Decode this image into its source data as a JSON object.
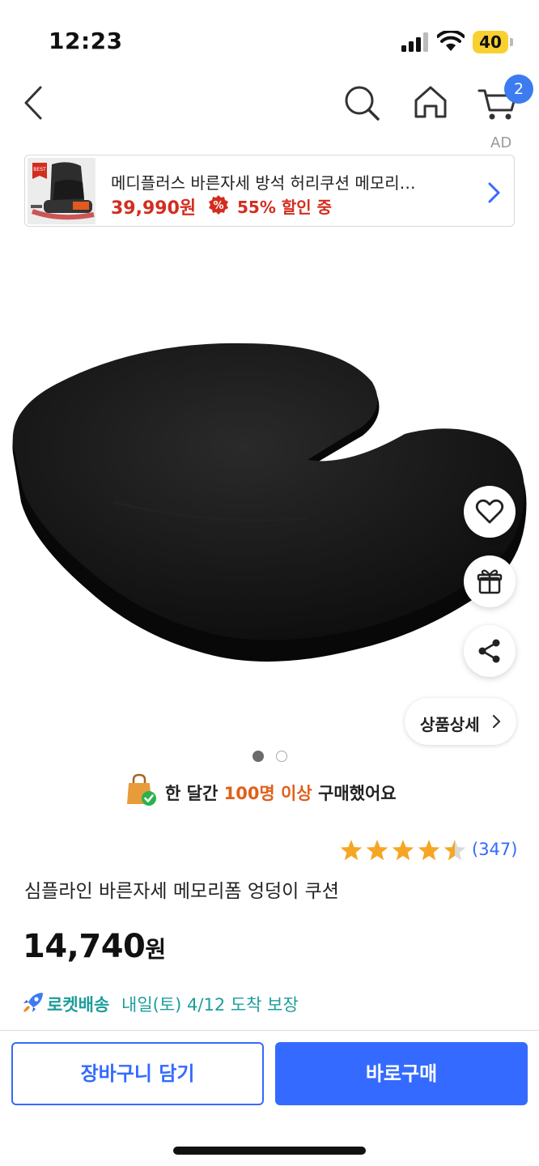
{
  "status_bar": {
    "time": "12:23",
    "battery": "40"
  },
  "nav": {
    "cart_count": "2",
    "ad_label": "AD"
  },
  "ad_banner": {
    "thumb_badge": "BEST",
    "title": "메디플러스 바른자세 방석 허리쿠션 메모리…",
    "price": "39,990원",
    "discount_icon": "%",
    "discount": "55% 할인 중"
  },
  "gallery": {
    "page_count": 2,
    "current_page": 1
  },
  "detail_button": {
    "label": "상품상세"
  },
  "purchase_notice": {
    "prefix": "한 달간 ",
    "highlight": "100명 이상",
    "suffix": " 구매했어요"
  },
  "rating": {
    "stars": 4.5,
    "count": "(347)"
  },
  "product": {
    "title": "심플라인 바른자세 메모리폼 엉덩이 쿠션",
    "price": "14,740",
    "currency": "원"
  },
  "delivery": {
    "label": "로켓배송",
    "text": "내일(토) 4/12 도착 보장"
  },
  "buttons": {
    "cart": "장바구니 담기",
    "buy": "바로구매"
  },
  "colors": {
    "accent": "#346aff",
    "sale": "#d32d1f",
    "rocket": "#1e9d9b",
    "highlight": "#e0601c",
    "star": "#f5a623"
  },
  "icons": [
    "back-icon",
    "search-icon",
    "home-icon",
    "cart-icon",
    "chevron-right-icon",
    "heart-icon",
    "gift-icon",
    "share-icon",
    "shopping-bag-icon",
    "star-icon",
    "rocket-icon",
    "signal-icon",
    "wifi-icon"
  ]
}
